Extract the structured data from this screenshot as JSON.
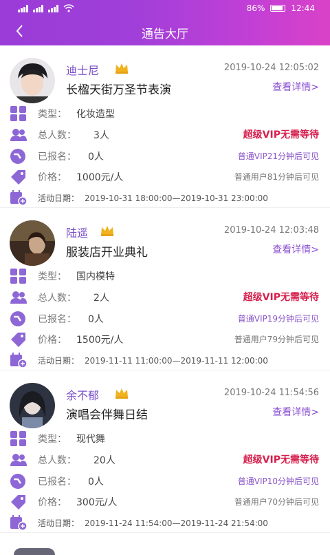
{
  "status": {
    "battery": "86%",
    "time": "12:44"
  },
  "header": {
    "title": "通告大厅"
  },
  "labels": {
    "type": "类型：",
    "total": "总人数：",
    "signed": "已报名：",
    "price": "价格：",
    "date": "活动日期：",
    "detail": "查看详情>",
    "vip_super": "超级VIP无需等待"
  },
  "colors": {
    "header_start": "#9a3cd8",
    "header_end": "#d942c8",
    "accent": "#8b4fd0",
    "vip_red": "#d61f4c"
  },
  "items": [
    {
      "name": "迪士尼",
      "time": "2019-10-24 12:05:02",
      "event": "长楹天街万圣节表演",
      "type": "化妆造型",
      "total": "3人",
      "signed": "0人",
      "price": "1000元/人",
      "vip_normal": "普通VIP21分钟后可见",
      "user_normal": "普通用户81分钟后可见",
      "date": "2019-10-31 18:00:00—2019-10-31 23:00:00"
    },
    {
      "name": "陆遥",
      "time": "2019-10-24 12:03:48",
      "event": "服装店开业典礼",
      "type": "国内模特",
      "total": "2人",
      "signed": "0人",
      "price": "1500元/人",
      "vip_normal": "普通VIP19分钟后可见",
      "user_normal": "普通用户79分钟后可见",
      "date": "2019-11-11 11:00:00—2019-11-11 12:00:00"
    },
    {
      "name": "余不郁",
      "time": "2019-10-24 11:54:56",
      "event": "演唱会伴舞日结",
      "type": "现代舞",
      "total": "20人",
      "signed": "0人",
      "price": "300元/人",
      "vip_normal": "普通VIP10分钟后可见",
      "user_normal": "普通用户70分钟后可见",
      "date": "2019-11-24 11:54:00—2019-11-24 21:54:00"
    }
  ]
}
